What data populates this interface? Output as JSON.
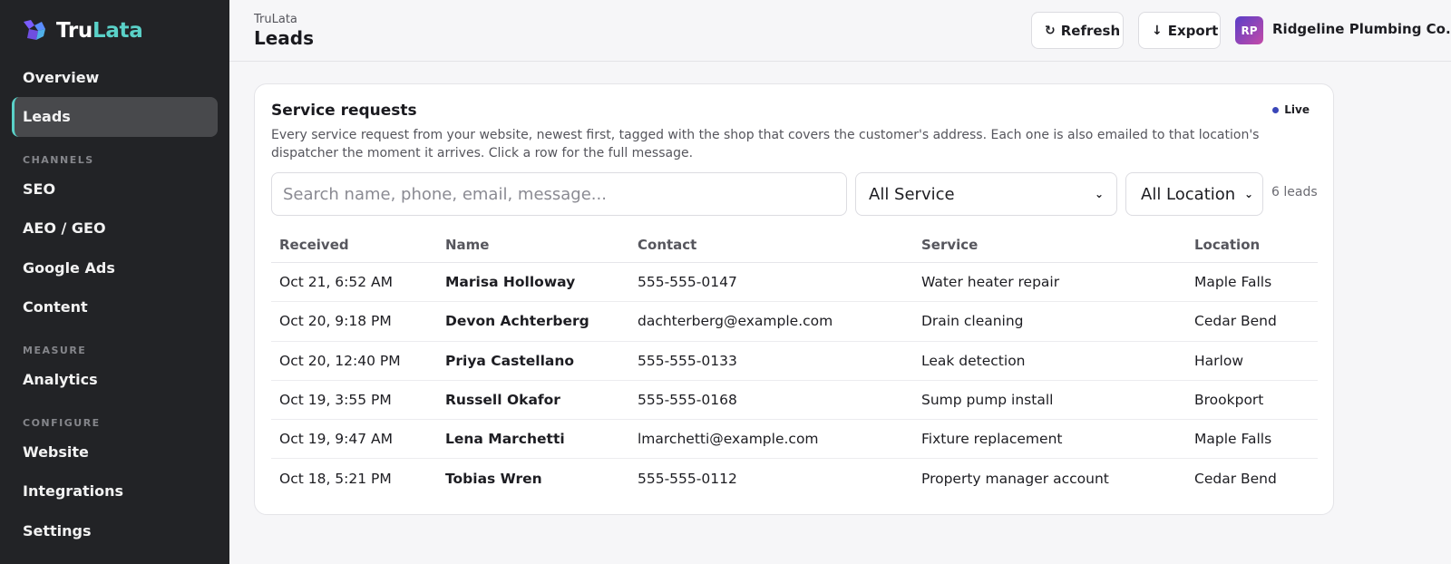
{
  "brand": {
    "part1": "Tru",
    "part2": "Lata"
  },
  "nav": {
    "overview": "Overview",
    "leads": "Leads",
    "channels_heading": "CHANNELS",
    "seo": "SEO",
    "aeo_geo": "AEO / GEO",
    "google_ads": "Google Ads",
    "content": "Content",
    "measure_heading": "MEASURE",
    "analytics": "Analytics",
    "configure_heading": "CONFIGURE",
    "website": "Website",
    "integrations": "Integrations",
    "settings": "Settings"
  },
  "header": {
    "breadcrumb": "TruLata",
    "title": "Leads",
    "refresh_label": "Refresh",
    "export_label": "Export",
    "avatar_initials": "RP",
    "account_name": "Ridgeline Plumbing Co."
  },
  "card": {
    "title": "Service requests",
    "live_label": "Live",
    "description": "Every service request from your website, newest first, tagged with the shop that covers the customer's address. Each one is also emailed to that location's dispatcher the moment it arrives. Click a row for the full message.",
    "search_placeholder": "Search name, phone, email, message...",
    "service_filter": "All Service",
    "location_filter": "All Location",
    "lead_count": "6 leads"
  },
  "table": {
    "columns": [
      "Received",
      "Name",
      "Contact",
      "Service",
      "Location"
    ],
    "rows": [
      [
        "Oct 21, 6:52 AM",
        "Marisa Holloway",
        "555-555-0147",
        "Water heater repair",
        "Maple Falls"
      ],
      [
        "Oct 20, 9:18 PM",
        "Devon Achterberg",
        "dachterberg@example.com",
        "Drain cleaning",
        "Cedar Bend"
      ],
      [
        "Oct 20, 12:40 PM",
        "Priya Castellano",
        "555-555-0133",
        "Leak detection",
        "Harlow"
      ],
      [
        "Oct 19, 3:55 PM",
        "Russell Okafor",
        "555-555-0168",
        "Sump pump install",
        "Brookport"
      ],
      [
        "Oct 19, 9:47 AM",
        "Lena Marchetti",
        "lmarchetti@example.com",
        "Fixture replacement",
        "Maple Falls"
      ],
      [
        "Oct 18, 5:21 PM",
        "Tobias Wren",
        "555-555-0112",
        "Property manager account",
        "Cedar Bend"
      ]
    ]
  },
  "colors": {
    "sidebar_bg": "#222326",
    "brand_accent": "#5ad1c8",
    "live_dot": "#3a46b8",
    "page_bg": "#f6f6f8"
  }
}
